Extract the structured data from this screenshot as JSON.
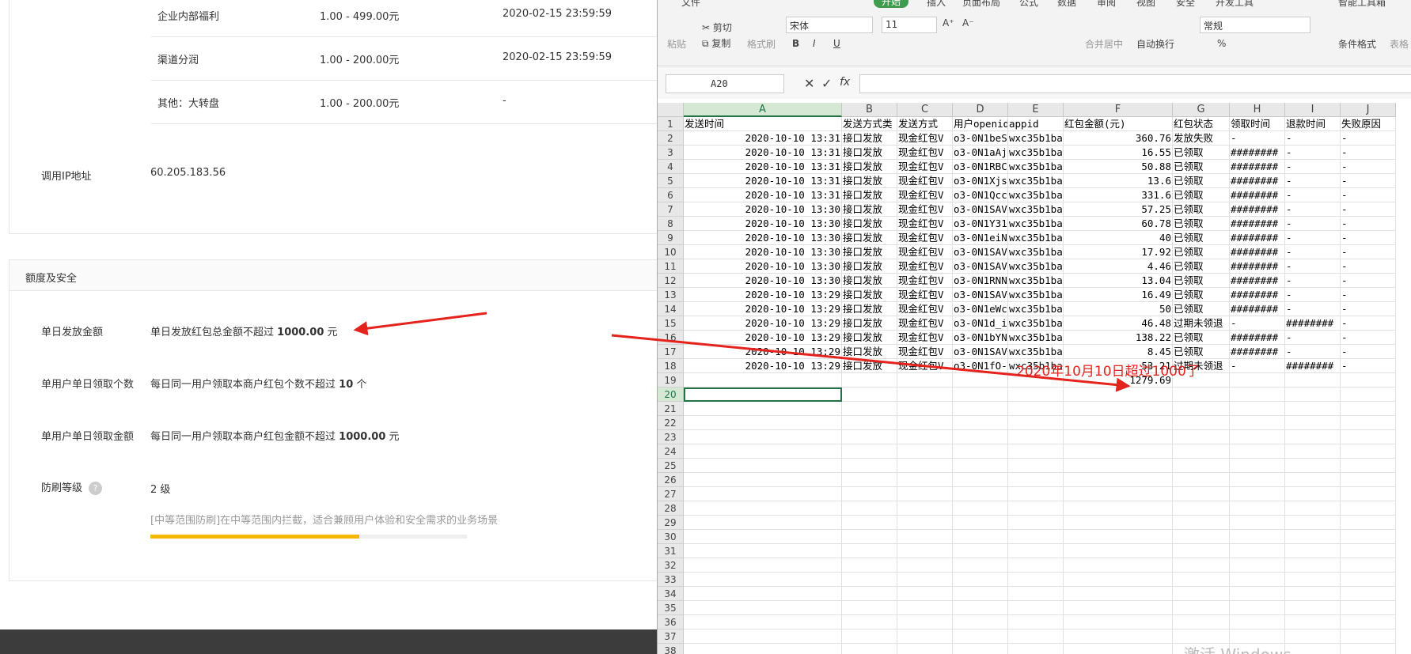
{
  "left_panel": {
    "top_rows": [
      {
        "name": "企业内部福利",
        "range": "1.00 - 499.00元",
        "time": "2020-02-15 23:59:59"
      },
      {
        "name": "渠道分润",
        "range": "1.00 - 200.00元",
        "time": "2020-02-15 23:59:59"
      },
      {
        "name": "其他：大转盘",
        "range": "1.00 - 200.00元",
        "time": "-"
      }
    ],
    "ip_label": "调用IP地址",
    "ip_value": "60.205.183.56",
    "section_title": "额度及安全",
    "daily_amount_label": "单日发放金额",
    "daily_amount_pre": "单日发放红包总金额不超过",
    "daily_amount_value": "1000.00",
    "daily_amount_unit": "元",
    "user_count_label": "单用户单日领取个数",
    "user_count_pre": "每日同一用户领取本商户红包个数不超过",
    "user_count_value": "10",
    "user_count_unit": "个",
    "user_amount_label": "单用户单日领取金额",
    "user_amount_pre": "每日同一用户领取本商户红包金额不超过",
    "user_amount_value": "1000.00",
    "user_amount_unit": "元",
    "anti_label": "防刷等级",
    "anti_help": "?",
    "anti_value": "2 级",
    "anti_desc": "[中等范围防刷]在中等范围内拦截，适合兼顾用户体验和安全需求的业务场景",
    "anti_progress": 0.66
  },
  "excel": {
    "menu": [
      "文件",
      "开始",
      "插入",
      "页面布局",
      "公式",
      "数据",
      "审阅",
      "视图",
      "安全",
      "开发工具",
      "智能工具箱"
    ],
    "active_menu": "开始",
    "ribbon": {
      "cut": "剪切",
      "copy": "复制",
      "paste": "粘贴",
      "format_painter": "格式刷",
      "font": "宋体",
      "size": "11",
      "merge": "合并居中",
      "wrap": "自动换行",
      "number_format": "常规",
      "cond_format": "条件格式",
      "table_style": "表格"
    },
    "name_box": "A20",
    "fx": "fx",
    "columns": [
      "A",
      "B",
      "C",
      "D",
      "E",
      "F",
      "G",
      "H",
      "I",
      "J"
    ],
    "headers": [
      "发送时间",
      "发送方式类",
      "发送方式",
      "用户openid",
      "appid",
      "红包金额(元)",
      "红包状态",
      "领取时间",
      "退款时间",
      "失败原因"
    ],
    "rows": [
      [
        "2020-10-10 13:31",
        "接口发放",
        "现金红包V",
        "o3-0N1beS",
        "wxc35b1ba",
        "360.76",
        "发放失败",
        "-",
        "-",
        "-"
      ],
      [
        "2020-10-10 13:31",
        "接口发放",
        "现金红包V",
        "o3-0N1aAj",
        "wxc35b1ba",
        "16.55",
        "已领取",
        "########",
        "-",
        "-"
      ],
      [
        "2020-10-10 13:31",
        "接口发放",
        "现金红包V",
        "o3-0N1RBC",
        "wxc35b1ba",
        "50.88",
        "已领取",
        "########",
        "-",
        "-"
      ],
      [
        "2020-10-10 13:31",
        "接口发放",
        "现金红包V",
        "o3-0N1Xjs",
        "wxc35b1ba",
        "13.6",
        "已领取",
        "########",
        "-",
        "-"
      ],
      [
        "2020-10-10 13:31",
        "接口发放",
        "现金红包V",
        "o3-0N1Qcc",
        "wxc35b1ba",
        "331.6",
        "已领取",
        "########",
        "-",
        "-"
      ],
      [
        "2020-10-10 13:30",
        "接口发放",
        "现金红包V",
        "o3-0N1SAV",
        "wxc35b1ba",
        "57.25",
        "已领取",
        "########",
        "-",
        "-"
      ],
      [
        "2020-10-10 13:30",
        "接口发放",
        "现金红包V",
        "o3-0N1Y31",
        "wxc35b1ba",
        "60.78",
        "已领取",
        "########",
        "-",
        "-"
      ],
      [
        "2020-10-10 13:30",
        "接口发放",
        "现金红包V",
        "o3-0N1eiN",
        "wxc35b1ba",
        "40",
        "已领取",
        "########",
        "-",
        "-"
      ],
      [
        "2020-10-10 13:30",
        "接口发放",
        "现金红包V",
        "o3-0N1SAV",
        "wxc35b1ba",
        "17.92",
        "已领取",
        "########",
        "-",
        "-"
      ],
      [
        "2020-10-10 13:30",
        "接口发放",
        "现金红包V",
        "o3-0N1SAV",
        "wxc35b1ba",
        "4.46",
        "已领取",
        "########",
        "-",
        "-"
      ],
      [
        "2020-10-10 13:30",
        "接口发放",
        "现金红包V",
        "o3-0N1RNN",
        "wxc35b1ba",
        "13.04",
        "已领取",
        "########",
        "-",
        "-"
      ],
      [
        "2020-10-10 13:29",
        "接口发放",
        "现金红包V",
        "o3-0N1SAV",
        "wxc35b1ba",
        "16.49",
        "已领取",
        "########",
        "-",
        "-"
      ],
      [
        "2020-10-10 13:29",
        "接口发放",
        "现金红包V",
        "o3-0N1eWc",
        "wxc35b1ba",
        "50",
        "已领取",
        "########",
        "-",
        "-"
      ],
      [
        "2020-10-10 13:29",
        "接口发放",
        "现金红包V",
        "o3-0N1d_i",
        "wxc35b1ba",
        "46.48",
        "过期未领退",
        "-",
        "########",
        "-"
      ],
      [
        "2020-10-10 13:29",
        "接口发放",
        "现金红包V",
        "o3-0N1bYN",
        "wxc35b1ba",
        "138.22",
        "已领取",
        "########",
        "-",
        "-"
      ],
      [
        "2020-10-10 13:29",
        "接口发放",
        "现金红包V",
        "o3-0N1SAV",
        "wxc35b1ba",
        "8.45",
        "已领取",
        "########",
        "-",
        "-"
      ],
      [
        "2020-10-10 13:29",
        "接口发放",
        "现金红包V",
        "o3-0N1fO-",
        "wxc35b1ba",
        "53.21",
        "过期未领退",
        "-",
        "########",
        "-"
      ]
    ],
    "sum": "1279.69",
    "row_numbers": [
      "1",
      "2",
      "3",
      "4",
      "5",
      "6",
      "7",
      "8",
      "9",
      "10",
      "11",
      "12",
      "13",
      "14",
      "15",
      "16",
      "17",
      "18",
      "19",
      "20",
      "21",
      "22",
      "23",
      "24",
      "25",
      "26",
      "27",
      "28",
      "29",
      "30",
      "31",
      "32",
      "33",
      "34",
      "35",
      "36",
      "37",
      "38"
    ],
    "active_row": "20",
    "annotation": "2020年10月10日超过1000了",
    "watermark": "激活 Windows"
  },
  "colors": {
    "accent_green": "#3f9b4e",
    "annotation_red": "#e5231d",
    "progress_yellow": "#f5b800"
  }
}
